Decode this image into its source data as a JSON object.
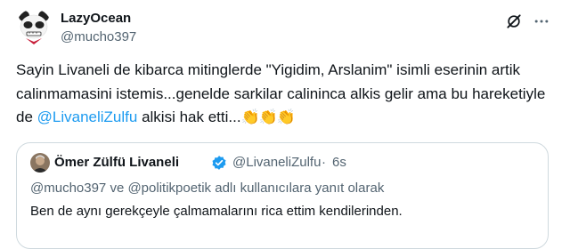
{
  "tweet": {
    "author": {
      "display_name": "LazyOcean",
      "handle": "@mucho397",
      "avatar_icon": "panda-avatar-icon"
    },
    "header_icons": [
      "grok-icon",
      "more-options-icon"
    ],
    "text_part1": "Sayin Livaneli de kibarca mitinglerde \"Yigidim, Arslanim\" isimli eserinin artik calinmamasini istemis...genelde sarkilar calininca alkis gelir ama bu hareketiyle de ",
    "mention": "@LivaneliZulfu",
    "text_part2": " alkisi hak etti...",
    "emojis": "👏👏👏",
    "link_color": "#1d9bf0"
  },
  "quote": {
    "display_name": "Ömer Zülfü Livaneli",
    "verified_icon": "verified-badge-icon",
    "verified_color": "#1d9bf0",
    "handle": "@LivaneliZulfu",
    "separator": "·",
    "time": "6s",
    "reply_context": "@mucho397 ve @politikpoetik adlı kullanıcılara yanıt olarak",
    "text": "Ben de aynı gerekçeyle çalmamalarını rica ettim kendilerinden."
  }
}
